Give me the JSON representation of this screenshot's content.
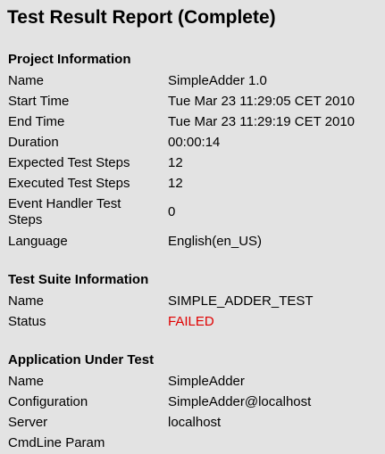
{
  "title": "Test Result Report (Complete)",
  "project": {
    "section_title": "Project Information",
    "rows": [
      {
        "label": "Name",
        "value": "SimpleAdder 1.0"
      },
      {
        "label": "Start Time",
        "value": "Tue Mar 23 11:29:05 CET 2010"
      },
      {
        "label": "End Time",
        "value": "Tue Mar 23 11:29:19 CET 2010"
      },
      {
        "label": "Duration",
        "value": "00:00:14"
      },
      {
        "label": "Expected Test Steps",
        "value": "12"
      },
      {
        "label": "Executed Test Steps",
        "value": "12"
      },
      {
        "label": "Event Handler Test Steps",
        "value": "0"
      },
      {
        "label": "Language",
        "value": "English(en_US)"
      }
    ]
  },
  "suite": {
    "section_title": "Test Suite Information",
    "rows": [
      {
        "label": "Name",
        "value": "SIMPLE_ADDER_TEST"
      },
      {
        "label": "Status",
        "value": "FAILED"
      }
    ],
    "status_color": "#e00000"
  },
  "aut": {
    "section_title": "Application Under Test",
    "rows": [
      {
        "label": "Name",
        "value": "SimpleAdder"
      },
      {
        "label": "Configuration",
        "value": "SimpleAdder@localhost"
      },
      {
        "label": "Server",
        "value": "localhost"
      },
      {
        "label": "CmdLine Param",
        "value": ""
      }
    ]
  }
}
